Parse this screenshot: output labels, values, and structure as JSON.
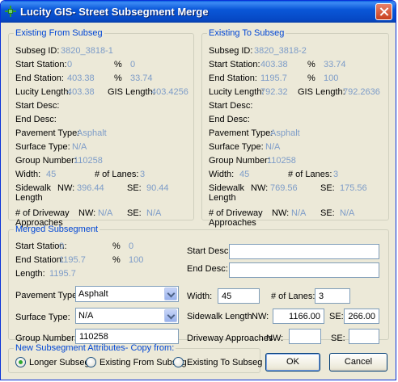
{
  "window": {
    "title": "Lucity GIS- Street Subsegment Merge"
  },
  "from": {
    "legend": "Existing From Subseg",
    "subseg_id_label": "Subseg ID:",
    "subseg_id": "3820_3818-1",
    "start_station_label": "Start Station:",
    "start_station": "0",
    "start_pct_label": "%",
    "start_pct": "0",
    "end_station_label": "End Station:",
    "end_station": "403.38",
    "end_pct_label": "%",
    "end_pct": "33.74",
    "lucity_length_label": "Lucity Length:",
    "lucity_length": "403.38",
    "gis_length_label": "GIS Length:",
    "gis_length": "403.4256",
    "start_desc_label": "Start Desc:",
    "end_desc_label": "End Desc:",
    "pavement_type_label": "Pavement Type:",
    "pavement_type": "Asphalt",
    "surface_type_label": "Surface Type:",
    "surface_type": "N/A",
    "group_number_label": "Group Number:",
    "group_number": "110258",
    "width_label": "Width:",
    "width": "45",
    "lanes_label": "# of Lanes:",
    "lanes": "3",
    "sidewalk_label_1": "Sidewalk",
    "sidewalk_label_2": "Length",
    "sidewalk_nw_label": "NW:",
    "sidewalk_nw": "396.44",
    "sidewalk_se_label": "SE:",
    "sidewalk_se": "90.44",
    "driveway_label_1": "# of Driveway",
    "driveway_label_2": "Approaches",
    "driveway_nw_label": "NW:",
    "driveway_nw": "N/A",
    "driveway_se_label": "SE:",
    "driveway_se": "N/A"
  },
  "to": {
    "legend": "Existing To Subseg",
    "subseg_id_label": "Subseg ID:",
    "subseg_id": "3820_3818-2",
    "start_station_label": "Start Station:",
    "start_station": "403.38",
    "start_pct_label": "%",
    "start_pct": "33.74",
    "end_station_label": "End Station:",
    "end_station": "1195.7",
    "end_pct_label": "%",
    "end_pct": "100",
    "lucity_length_label": "Lucity Length:",
    "lucity_length": "792.32",
    "gis_length_label": "GIS Length:",
    "gis_length": "792.2636",
    "start_desc_label": "Start Desc:",
    "end_desc_label": "End Desc:",
    "pavement_type_label": "Pavement Type:",
    "pavement_type": "Asphalt",
    "surface_type_label": "Surface Type:",
    "surface_type": "N/A",
    "group_number_label": "Group Number:",
    "group_number": "110258",
    "width_label": "Width:",
    "width": "45",
    "lanes_label": "# of Lanes:",
    "lanes": "3",
    "sidewalk_label_1": "Sidewalk",
    "sidewalk_label_2": "Length",
    "sidewalk_nw_label": "NW:",
    "sidewalk_nw": "769.56",
    "sidewalk_se_label": "SE:",
    "sidewalk_se": "175.56",
    "driveway_label_1": "# of Driveway",
    "driveway_label_2": "Approaches",
    "driveway_nw_label": "NW:",
    "driveway_nw": "N/A",
    "driveway_se_label": "SE:",
    "driveway_se": "N/A"
  },
  "merged": {
    "legend": "Merged Subsegment",
    "start_station_label": "Start Station:",
    "start_station": "0",
    "start_pct_label": "%",
    "start_pct": "0",
    "end_station_label": "End Station:",
    "end_station": "1195.7",
    "end_pct_label": "%",
    "end_pct": "100",
    "length_label": "Length:",
    "length": "1195.7",
    "start_desc_label": "Start Desc:",
    "start_desc": "",
    "end_desc_label": "End Desc:",
    "end_desc": "",
    "pavement_type_label": "Pavement Type:",
    "pavement_type": "Asphalt",
    "surface_type_label": "Surface Type:",
    "surface_type": "N/A",
    "group_number_label": "Group Number:",
    "group_number": "110258",
    "width_label": "Width:",
    "width": "45",
    "lanes_label": "# of Lanes:",
    "lanes": "3",
    "sidewalk_label": "Sidewalk Length",
    "sidewalk_nw_label": "NW:",
    "sidewalk_nw": "1166.00",
    "sidewalk_se_label": "SE:",
    "sidewalk_se": "266.00",
    "driveway_label": "Driveway Approaches",
    "driveway_nw_label": "NW:",
    "driveway_nw": "",
    "driveway_se_label": "SE:",
    "driveway_se": ""
  },
  "copy_from": {
    "legend": "New Subsegment Attributes- Copy from:",
    "options": [
      "Longer Subseg",
      "Existing From Subseg",
      "Existing To Subseg"
    ],
    "selected": "Longer Subseg"
  },
  "buttons": {
    "ok": "OK",
    "cancel": "Cancel"
  },
  "colors": {
    "title_bar": "#0a57d8",
    "legend_text": "#0046d5",
    "readonly_value": "#7d9cc8",
    "selected_radio": "#2fa82f"
  }
}
